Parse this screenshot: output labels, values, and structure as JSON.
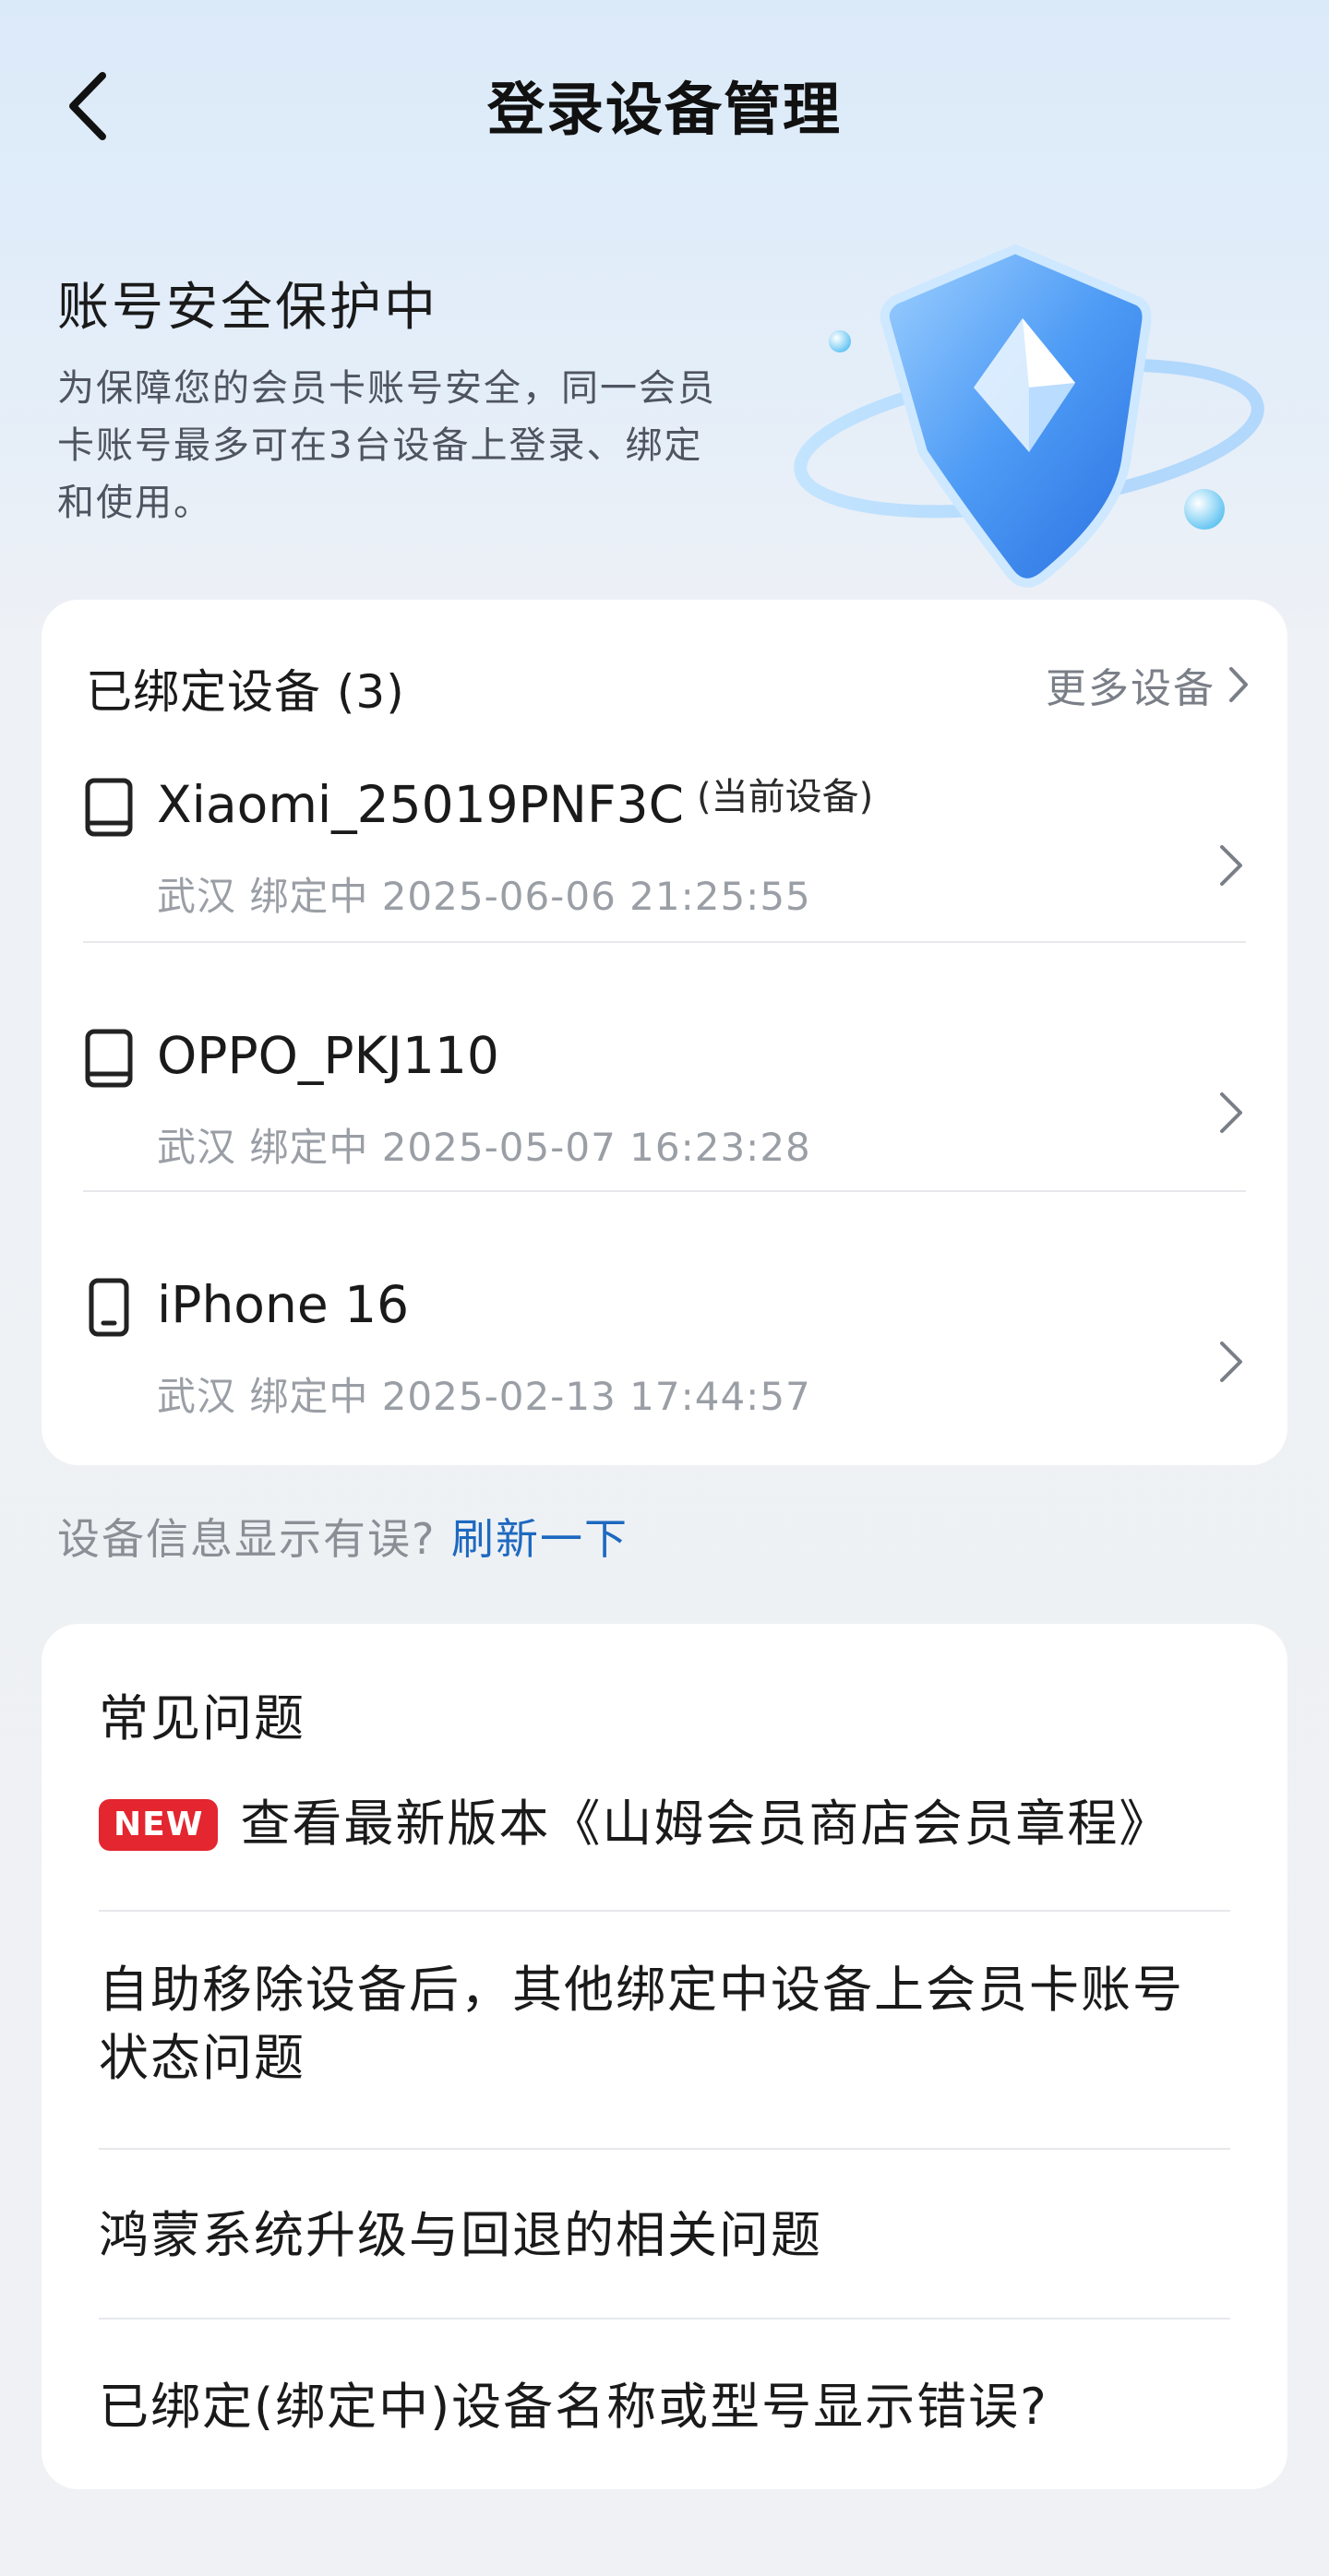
{
  "header": {
    "title": "登录设备管理"
  },
  "hero": {
    "title": "账号安全保护中",
    "description": "为保障您的会员卡账号安全，同一会员卡账号最多可在3台设备上登录、绑定和使用。"
  },
  "devices": {
    "title": "已绑定设备 (3)",
    "more_label": "更多设备",
    "items": [
      {
        "name": "Xiaomi_25019PNF3C",
        "tag": "(当前设备)",
        "meta": "武汉 绑定中 2025-06-06 21:25:55",
        "icon": "tablet-icon"
      },
      {
        "name": "OPPO_PKJ110",
        "tag": "",
        "meta": "武汉 绑定中 2025-05-07 16:23:28",
        "icon": "tablet-icon"
      },
      {
        "name": "iPhone 16",
        "tag": "",
        "meta": "武汉 绑定中 2025-02-13 17:44:57",
        "icon": "phone-icon"
      }
    ]
  },
  "refresh": {
    "prompt": "设备信息显示有误?",
    "link": "刷新一下"
  },
  "faq": {
    "title": "常见问题",
    "badge": "NEW",
    "items": [
      "查看最新版本《山姆会员商店会员章程》",
      "自助移除设备后，其他绑定中设备上会员卡账号状态问题",
      "鸿蒙系统升级与回退的相关问题",
      "已绑定(绑定中)设备名称或型号显示错误?"
    ]
  },
  "colors": {
    "accent_link": "#1d69c0",
    "badge_red": "#e3262f",
    "shield_blue": "#3f8ff0"
  }
}
